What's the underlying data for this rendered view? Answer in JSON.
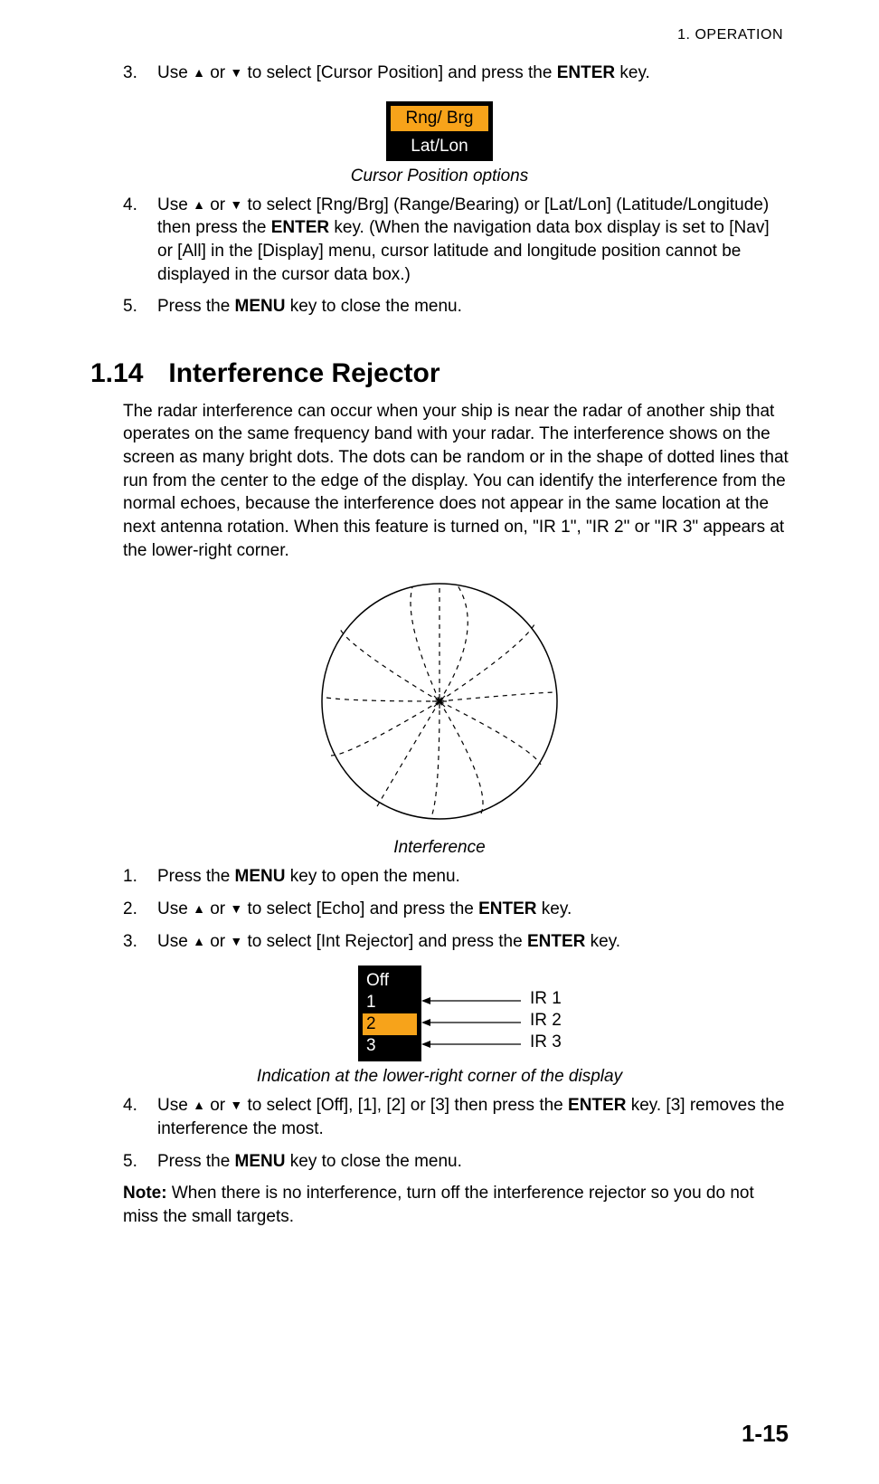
{
  "runningHead": "1.  OPERATION",
  "pageNumber": "1-15",
  "glyphs": {
    "up": "▲",
    "down": "▼"
  },
  "section_a": {
    "step3": {
      "num": "3.",
      "pre": "Use ",
      "mid": " or ",
      "post1": " to select [Cursor Position] and press the ",
      "bold": "ENTER",
      "post2": " key."
    },
    "optionBox": {
      "sel": "Rng/ Brg",
      "other": "Lat/Lon"
    },
    "caption1": "Cursor Position options",
    "step4": {
      "num": "4.",
      "pre": "Use ",
      "mid": " or ",
      "post1": " to select [Rng/Brg] (Range/Bearing) or [Lat/Lon] (Latitude/Longitude) then press the ",
      "bold": "ENTER",
      "post2": " key. (When the navigation data box display is set to [Nav] or [All] in the [Display] menu, cursor latitude and longitude position cannot be displayed in the cursor data box.)"
    },
    "step5": {
      "num": "5.",
      "pre": "Press the ",
      "bold": "MENU",
      "post": " key to close the menu."
    }
  },
  "section_114": {
    "number": "1.14",
    "title": "Interference Rejector",
    "para": "The radar interference can occur when your ship is near the radar of another ship that operates on the same frequency band with your radar. The interference shows on the screen as many bright dots. The dots can be random or in the shape of dotted lines that run from the center to the edge of the display. You can identify the interference from the normal echoes, because the interference does not appear in the same location at the next antenna rotation. When this feature is turned on, \"IR 1\", \"IR 2\" or \"IR 3\" appears at the lower-right corner.",
    "caption_radar": "Interference",
    "steps": {
      "s1": {
        "num": "1.",
        "pre": "Press the ",
        "bold": "MENU",
        "post": " key to open the menu."
      },
      "s2": {
        "num": "2.",
        "pre": "Use ",
        "mid": " or ",
        "post1": " to select [Echo] and press the ",
        "bold": "ENTER",
        "post2": " key."
      },
      "s3": {
        "num": "3.",
        "pre": "Use ",
        "mid": " or ",
        "post1": " to select [Int Rejector] and press the ",
        "bold": "ENTER",
        "post2": " key."
      },
      "s4": {
        "num": "4.",
        "pre": "Use ",
        "mid": " or ",
        "post1": " to select [Off], [1], [2] or [3] then press the ",
        "bold": "ENTER",
        "post2": " key. [3] removes the interference the most."
      },
      "s5": {
        "num": "5.",
        "pre": "Press the ",
        "bold": "MENU",
        "post": " key to close the menu."
      }
    },
    "irBox": {
      "items": [
        "Off",
        "1",
        "2",
        "3"
      ],
      "selectedIndex": 2,
      "labels": [
        "IR 1",
        "IR 2",
        "IR 3"
      ]
    },
    "caption_ir": "Indication at the lower-right corner of the display",
    "note": {
      "bold": "Note:",
      "text": " When there is no interference, turn off the interference rejector so you do not miss the small targets."
    }
  }
}
